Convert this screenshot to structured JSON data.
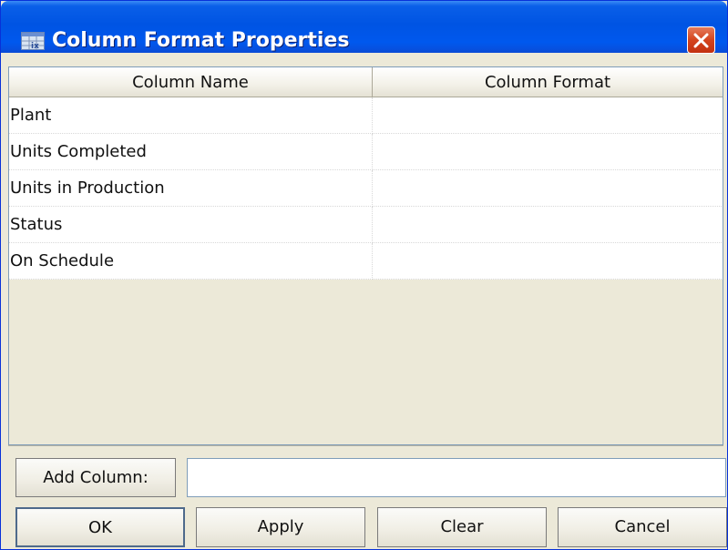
{
  "window": {
    "title": "Column Format Properties",
    "icon": "table-icon",
    "close_icon": "close-icon"
  },
  "table": {
    "columns": [
      "Column Name",
      "Column Format"
    ],
    "rows": [
      {
        "name": "Plant",
        "format": ""
      },
      {
        "name": "Units Completed",
        "format": ""
      },
      {
        "name": "Units in Production",
        "format": ""
      },
      {
        "name": "Status",
        "format": ""
      },
      {
        "name": "On Schedule",
        "format": ""
      }
    ]
  },
  "add_column": {
    "button_label": "Add Column:",
    "input_value": ""
  },
  "buttons": {
    "ok": "OK",
    "apply": "Apply",
    "clear": "Clear",
    "cancel": "Cancel"
  },
  "colors": {
    "titlebar": "#0054e3",
    "close_button": "#d4441e",
    "dialog_background": "#ece9d8"
  }
}
